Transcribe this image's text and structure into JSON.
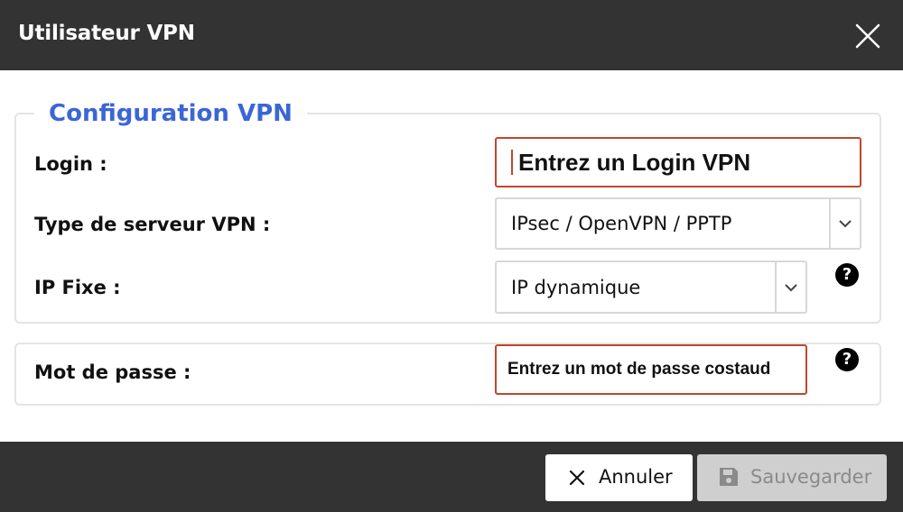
{
  "header": {
    "title": "Utilisateur VPN",
    "close_icon": "close-icon"
  },
  "section": {
    "legend": "Configuration VPN"
  },
  "form": {
    "login": {
      "label": "Login :",
      "placeholder": "Entrez un Login VPN"
    },
    "server_type": {
      "label": "Type de serveur VPN :",
      "value": "IPsec / OpenVPN / PPTP"
    },
    "ip_fixe": {
      "label": "IP Fixe :",
      "value": "IP dynamique",
      "help": "?"
    },
    "password": {
      "label": "Mot de passe :",
      "placeholder": "Entrez un mot de passe costaud",
      "help": "?"
    }
  },
  "footer": {
    "cancel_label": "Annuler",
    "save_label": "Sauvegarder"
  },
  "colors": {
    "header_bg": "#333333",
    "legend": "#3a66d6",
    "invalid_border": "#c0462e",
    "disabled_button": "#cfcfcf"
  }
}
